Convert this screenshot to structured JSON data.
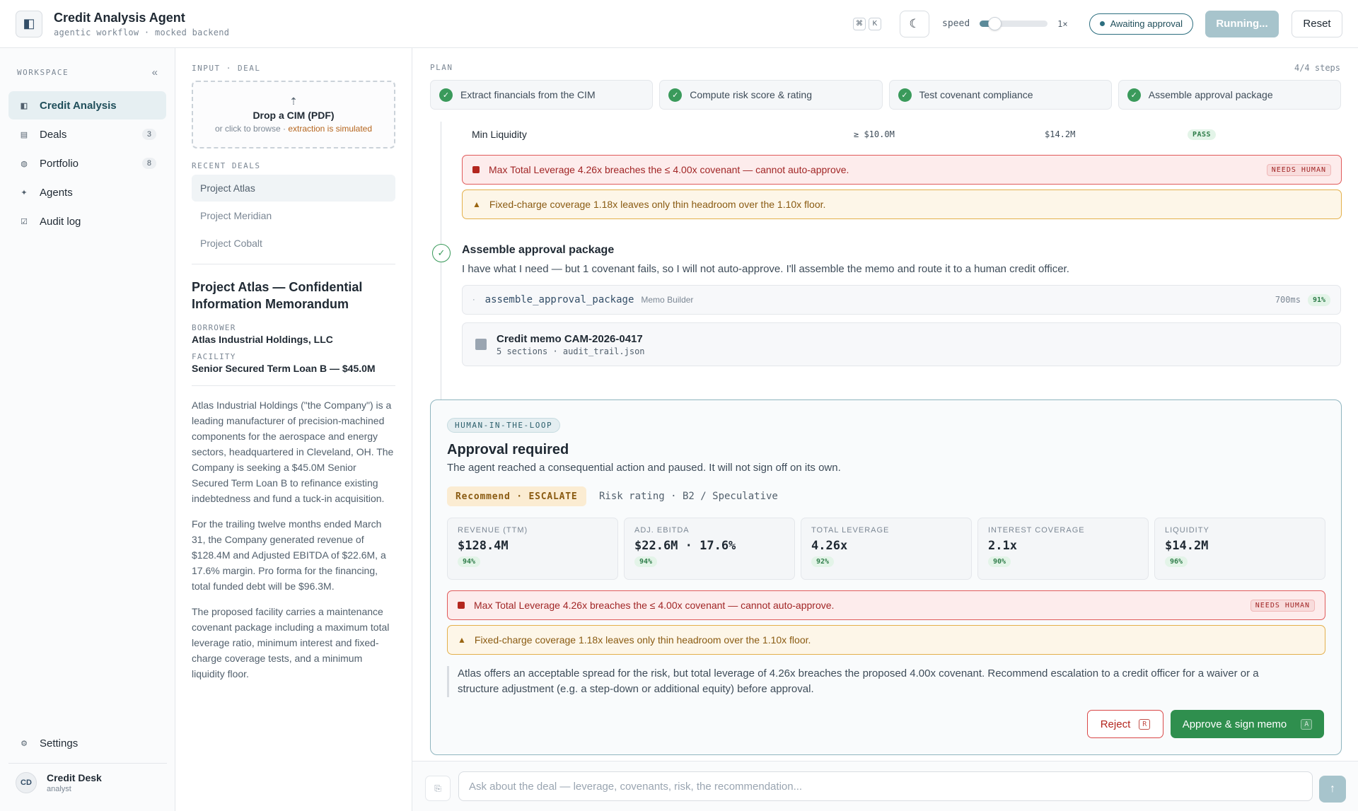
{
  "app": {
    "title": "Credit Analysis Agent",
    "subtitle": "agentic workflow · mocked backend",
    "sidebar_toggle_icon": "sidebar-toggle-icon"
  },
  "topbar": {
    "kbd_cmd": "⌘",
    "kbd_k": "K",
    "theme_icon": "moon-icon",
    "speed_label": "speed",
    "speed_value": "1×",
    "speed_level": 0.12,
    "status": "Awaiting approval",
    "running_label": "Running...",
    "reset_label": "Reset",
    "accent_color": "#2c6e7f"
  },
  "sidebar": {
    "section_label": "WORKSPACE",
    "collapse_glyph": "«",
    "items": [
      {
        "label": "Credit Analysis",
        "icon": "◧",
        "count": ""
      },
      {
        "label": "Deals",
        "icon": "▤",
        "count": "3"
      },
      {
        "label": "Portfolio",
        "icon": "◍",
        "count": "8"
      },
      {
        "label": "Agents",
        "icon": "✦",
        "count": ""
      },
      {
        "label": "Audit log",
        "icon": "☑",
        "count": ""
      }
    ],
    "settings_label": "Settings",
    "settings_icon": "⚙",
    "user": {
      "initials": "CD",
      "name": "Credit Desk",
      "role": "analyst"
    }
  },
  "deal": {
    "input_label": "INPUT · DEAL",
    "dropzone": {
      "arrow": "⇡",
      "title": "Drop a CIM (PDF)",
      "sub_prefix": "or click to browse · ",
      "sub_accent": "extraction is simulated"
    },
    "recent_label": "RECENT DEALS",
    "recent": [
      "Project Atlas",
      "Project Meridian",
      "Project Cobalt"
    ],
    "doc_title": "Project Atlas — Confidential Information Memorandum",
    "borrower_label": "BORROWER",
    "borrower": "Atlas Industrial Holdings, LLC",
    "facility_label": "FACILITY",
    "facility": "Senior Secured Term Loan B — $45.0M",
    "paragraphs": [
      "Atlas Industrial Holdings (\"the Company\") is a leading manufacturer of precision-machined components for the aerospace and energy sectors, headquartered in Cleveland, OH. The Company is seeking a $45.0M Senior Secured Term Loan B to refinance existing indebtedness and fund a tuck-in acquisition.",
      "For the trailing twelve months ended March 31, the Company generated revenue of $128.4M and Adjusted EBITDA of $22.6M, a 17.6% margin. Pro forma for the financing, total funded debt will be $96.3M.",
      "The proposed facility carries a maintenance covenant package including a maximum total leverage ratio, minimum interest and fixed-charge coverage tests, and a minimum liquidity floor."
    ]
  },
  "plan": {
    "label": "PLAN",
    "count": "4/4 steps",
    "steps": [
      "Extract financials from the CIM",
      "Compute risk score & rating",
      "Test covenant compliance",
      "Assemble approval package"
    ]
  },
  "covenant_row": {
    "name": "Min Liquidity",
    "threshold": "≥ $10.0M",
    "actual": "$14.2M",
    "result": "PASS"
  },
  "alerts": {
    "leverage": "Max Total Leverage 4.26x breaches the ≤ 4.00x covenant — cannot auto-approve.",
    "needs_human": "NEEDS HUMAN",
    "fcc": "Fixed-charge coverage 1.18x leaves only thin headroom over the 1.10x floor."
  },
  "assemble": {
    "title": "Assemble approval package",
    "desc": "I have what I need — but 1 covenant fails, so I will not auto-approve. I'll assemble the memo and route it to a human credit officer.",
    "tool_name": "assemble_approval_package",
    "tool_service": "Memo Builder",
    "tool_ms": "700ms",
    "tool_conf": "91%",
    "memo_title": "Credit memo CAM-2026-0417",
    "memo_sub": "5 sections · audit_trail.json"
  },
  "approval": {
    "badge": "HUMAN-IN-THE-LOOP",
    "title": "Approval required",
    "sub": "The agent reached a consequential action and paused. It will not sign off on its own.",
    "recommend": "Recommend · ESCALATE",
    "risk": "Risk rating · B2 / Speculative",
    "metrics": [
      {
        "label": "REVENUE (TTM)",
        "value": "$128.4M",
        "conf": "94%"
      },
      {
        "label": "ADJ. EBITDA",
        "value": "$22.6M · 17.6%",
        "conf": "94%"
      },
      {
        "label": "TOTAL LEVERAGE",
        "value": "4.26x",
        "conf": "92%"
      },
      {
        "label": "INTEREST COVERAGE",
        "value": "2.1x",
        "conf": "90%"
      },
      {
        "label": "LIQUIDITY",
        "value": "$14.2M",
        "conf": "96%"
      }
    ],
    "rationale": "Atlas offers an acceptable spread for the risk, but total leverage of 4.26x breaches the proposed 4.00x covenant. Recommend escalation to a credit officer for a waiver or a structure adjustment (e.g. a step-down or additional equity) before approval.",
    "reject_label": "Reject",
    "reject_kbd": "R",
    "approve_label": "Approve & sign memo",
    "approve_kbd": "A"
  },
  "chat": {
    "placeholder": "Ask about the deal — leverage, covenants, risk, the recommendation...",
    "attach_icon": "⎘",
    "send_icon": "↑"
  }
}
